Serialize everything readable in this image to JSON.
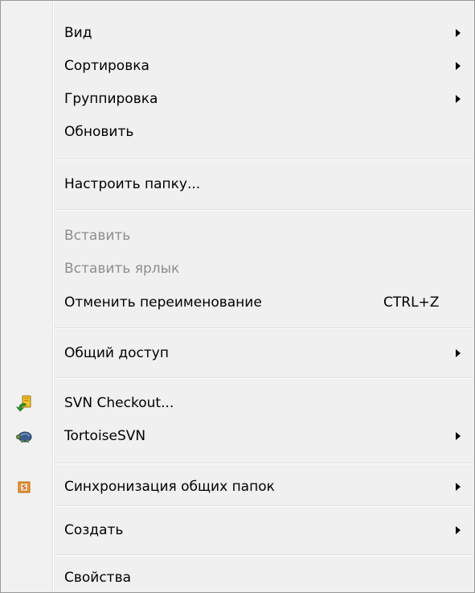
{
  "menu": {
    "items": [
      {
        "label": "Вид"
      },
      {
        "label": "Сортировка"
      },
      {
        "label": "Группировка"
      },
      {
        "label": "Обновить"
      },
      {
        "label": "Настроить папку..."
      },
      {
        "label": "Вставить"
      },
      {
        "label": "Вставить ярлык"
      },
      {
        "label": "Отменить переименование",
        "shortcut": "CTRL+Z"
      },
      {
        "label": "Общий доступ"
      },
      {
        "label": "SVN Checkout...",
        "icon": "svn-checkout-icon"
      },
      {
        "label": "TortoiseSVN",
        "icon": "tortoisesvn-icon"
      },
      {
        "label": "Синхронизация общих папок",
        "icon": "sharepoint-sync-icon"
      },
      {
        "label": "Создать"
      },
      {
        "label": "Свойства"
      }
    ]
  },
  "colors": {
    "background": "#f0f0f0",
    "border": "#979797",
    "disabled_text": "#8d8d8d"
  }
}
